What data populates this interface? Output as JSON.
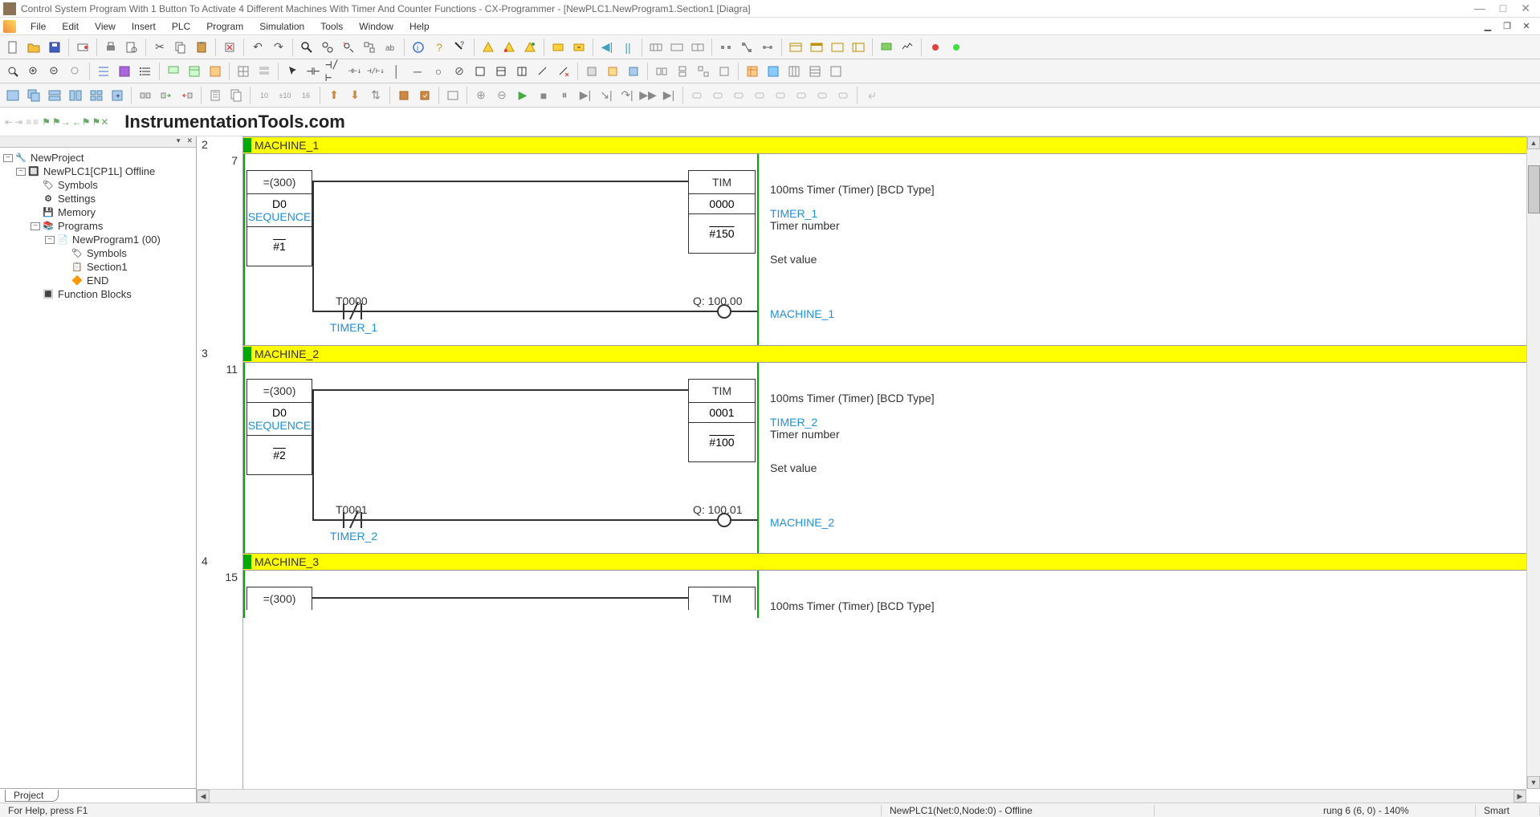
{
  "title_bar": {
    "title": "Control System Program With 1 Button To Activate 4 Different Machines With Timer And Counter Functions - CX-Programmer - [NewPLC1.NewProgram1.Section1 [Diagra]"
  },
  "menu": {
    "items": [
      "File",
      "Edit",
      "View",
      "Insert",
      "PLC",
      "Program",
      "Simulation",
      "Tools",
      "Window",
      "Help"
    ]
  },
  "brand": "InstrumentationTools.com",
  "tree": {
    "root": "NewProject",
    "plc": "NewPLC1[CP1L] Offline",
    "nodes": {
      "symbols": "Symbols",
      "settings": "Settings",
      "memory": "Memory",
      "programs": "Programs",
      "newprogram": "NewProgram1 (00)",
      "p_symbols": "Symbols",
      "section1": "Section1",
      "end": "END",
      "fb": "Function Blocks"
    },
    "tab": "Project"
  },
  "ladder": {
    "rung2_num": "2",
    "rung2_addr": "7",
    "rung3_num": "3",
    "rung3_addr": "11",
    "rung4_num": "4",
    "rung4_addr": "15",
    "m1_header": "MACHINE_1",
    "m2_header": "MACHINE_2",
    "m3_header": "MACHINE_3",
    "eq_fn": "=(300)",
    "d0": "D0",
    "sequence": "SEQUENCE",
    "hash1": "#1",
    "hash2": "#2",
    "tim": "TIM",
    "t0000": "0000",
    "t0001": "0001",
    "sv150": "#150",
    "sv100": "#100",
    "t0000_lbl": "T0000",
    "t0001_lbl": "T0001",
    "timer1": "TIMER_1",
    "timer2": "TIMER_2",
    "q10000": "Q: 100.00",
    "q10001": "Q: 100.01",
    "machine1": "MACHINE_1",
    "machine2": "MACHINE_2",
    "desc_100ms": "100ms Timer (Timer) [BCD Type]",
    "desc_timer_num": "Timer number",
    "desc_set_value": "Set value"
  },
  "status": {
    "help": "For Help, press F1",
    "net": "NewPLC1(Net:0,Node:0) - Offline",
    "rung": "rung 6 (6, 0)  - 140%",
    "smart": "Smart"
  }
}
